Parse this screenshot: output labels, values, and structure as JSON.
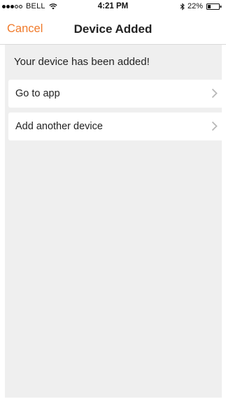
{
  "status_bar": {
    "carrier": "BELL",
    "time": "4:21 PM",
    "battery": "22%",
    "signal_bars_filled": 3,
    "signal_bars_total": 5
  },
  "nav": {
    "cancel_label": "Cancel",
    "title": "Device Added"
  },
  "content": {
    "message": "Your device has been added!",
    "rows": [
      {
        "label": "Go to app",
        "icon": "chevron-right-icon"
      },
      {
        "label": "Add another device",
        "icon": "chevron-right-icon"
      }
    ]
  },
  "colors": {
    "accent": "#f07a2a",
    "background": "#efefef",
    "row_background": "#ffffff"
  }
}
